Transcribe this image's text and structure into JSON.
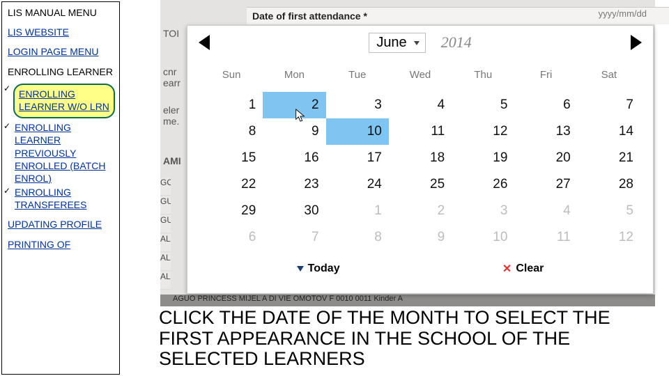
{
  "sidebar": {
    "title": "LIS MANUAL MENU",
    "website": "LIS WEBSITE",
    "login_menu": "LOGIN PAGE MENU",
    "enrolling_head": "ENROLLING LEARNER",
    "items": [
      "ENROLLING LEARNER W/O LRN",
      "ENROLLING LEARNER PREVIOUSLY ENROLLED (BATCH ENROL)",
      "ENROLLING TRANSFEREES"
    ],
    "updating": "UPDATING PROFILE",
    "printing": "PRINTING OF"
  },
  "form": {
    "field_label": "Date of first attendance *",
    "placeholder": "yyyy/mm/dd",
    "bg": {
      "top_left": "TOI",
      "l1a": "cnr",
      "l1b": "earr",
      "l2a": "eler",
      "l2b": "me.",
      "ami": "AMI",
      "rows": [
        "GON",
        "GUI",
        "GUI",
        "ALU",
        "ALU",
        "ALU"
      ],
      "strip": "AGUO  PRINCESS MIJEL A DI VIE OMOTOV            F          0010  0011      Kinder   A"
    }
  },
  "calendar": {
    "month": "June",
    "year": "2014",
    "dow": [
      "Sun",
      "Mon",
      "Tue",
      "Wed",
      "Thu",
      "Fri",
      "Sat"
    ],
    "days": [
      {
        "n": "",
        "cls": "blank"
      },
      {
        "n": "1"
      },
      {
        "n": "2",
        "hi": true,
        "cur": true
      },
      {
        "n": "3"
      },
      {
        "n": "4"
      },
      {
        "n": "5"
      },
      {
        "n": "6"
      },
      {
        "n": "7"
      },
      {
        "n": "8"
      },
      {
        "n": "9"
      },
      {
        "n": "10",
        "hi": true
      },
      {
        "n": "11"
      },
      {
        "n": "12"
      },
      {
        "n": "13"
      },
      {
        "n": "14"
      },
      {
        "n": "15"
      },
      {
        "n": "16"
      },
      {
        "n": "17"
      },
      {
        "n": "18"
      },
      {
        "n": "19"
      },
      {
        "n": "20"
      },
      {
        "n": "21"
      },
      {
        "n": "22"
      },
      {
        "n": "23"
      },
      {
        "n": "24"
      },
      {
        "n": "25"
      },
      {
        "n": "26"
      },
      {
        "n": "27"
      },
      {
        "n": "28"
      },
      {
        "n": "29"
      },
      {
        "n": "30"
      },
      {
        "n": "1",
        "nx": true
      },
      {
        "n": "2",
        "nx": true
      },
      {
        "n": "3",
        "nx": true
      },
      {
        "n": "4",
        "nx": true
      },
      {
        "n": "5",
        "nx": true
      },
      {
        "n": "6",
        "nx": true
      },
      {
        "n": "7",
        "nx": true
      },
      {
        "n": "8",
        "nx": true
      },
      {
        "n": "9",
        "nx": true
      },
      {
        "n": "10",
        "nx": true
      },
      {
        "n": "11",
        "nx": true
      },
      {
        "n": "12",
        "nx": true
      }
    ],
    "today": "Today",
    "clear": "Clear"
  },
  "instruction": "CLICK THE DATE OF THE MONTH TO SELECT THE FIRST APPEARANCE IN THE SCHOOL OF THE SELECTED LEARNERS"
}
